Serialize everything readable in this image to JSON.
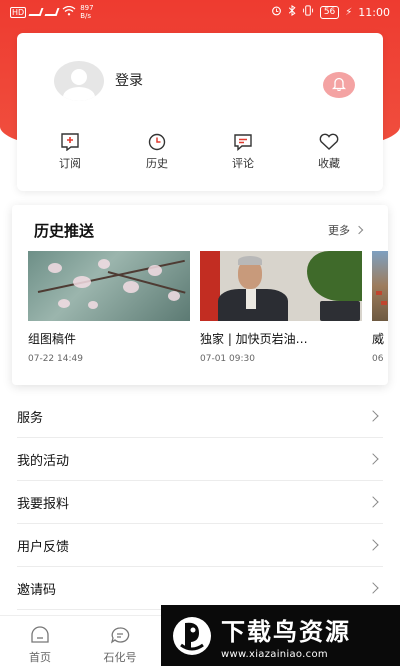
{
  "status_bar": {
    "left_text": "HD",
    "net_speed": "897\nB/s",
    "battery": "56",
    "time": "11:00"
  },
  "profile": {
    "login_label": "登录",
    "quick_actions": [
      {
        "label": "订阅",
        "icon": "subscribe-icon"
      },
      {
        "label": "历史",
        "icon": "clock-icon"
      },
      {
        "label": "评论",
        "icon": "comment-icon"
      },
      {
        "label": "收藏",
        "icon": "heart-icon"
      }
    ]
  },
  "history": {
    "title": "历史推送",
    "more_label": "更多",
    "items": [
      {
        "title": "组图稿件",
        "time": "07-22 14:49"
      },
      {
        "title": "独家 | 加快页岩油…",
        "time": "07-01 09:30"
      },
      {
        "title": "威",
        "time": "06"
      }
    ]
  },
  "menu": [
    {
      "label": "服务"
    },
    {
      "label": "我的活动"
    },
    {
      "label": "我要报料"
    },
    {
      "label": "用户反馈"
    },
    {
      "label": "邀请码"
    }
  ],
  "tabs": [
    {
      "label": "首页"
    },
    {
      "label": "石化号"
    }
  ],
  "watermark": {
    "main": "下载鸟资源",
    "url": "www.xiazainiao.com"
  },
  "colors": {
    "brand_red": "#ee3b30",
    "bell_pink": "#f4a3a3"
  }
}
